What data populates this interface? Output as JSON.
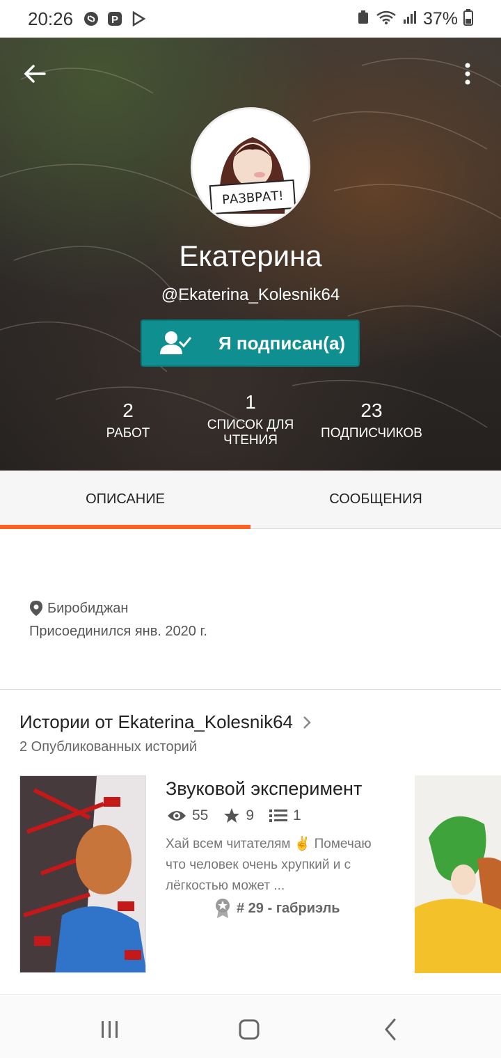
{
  "status_bar": {
    "time": "20:26",
    "battery": "37%"
  },
  "profile": {
    "name": "Екатерина",
    "handle": "@Ekaterina_Kolesnik64",
    "follow_label": "Я подписан(а)",
    "avatar_sign_text": "РАЗВРАТ!",
    "stats": [
      {
        "value": "2",
        "label": "РАБОТ"
      },
      {
        "value": "1",
        "label": "СПИСОК ДЛЯ ЧТЕНИЯ"
      },
      {
        "value": "23",
        "label": "ПОДПИСЧИКОВ"
      }
    ]
  },
  "tabs": [
    {
      "label": "ОПИСАНИЕ",
      "active": true
    },
    {
      "label": "СООБЩЕНИЯ",
      "active": false
    }
  ],
  "about": {
    "location": "Биробиджан",
    "joined": "Присоединился янв. 2020 г."
  },
  "stories_section": {
    "title": "Истории от Ekaterina_Kolesnik64",
    "subtitle": "2 Опубликованных историй",
    "story": {
      "title": "Звуковой эксперимент",
      "views": "55",
      "votes": "9",
      "parts": "1",
      "description": "Хай всем читателям ✌️ Помечаю что человек очень хрупкий и с лёгкостью может ...",
      "rank": "# 29 - габриэль"
    }
  },
  "colors": {
    "accent": "#ff6122",
    "follow_button": "#0f8f8f"
  }
}
